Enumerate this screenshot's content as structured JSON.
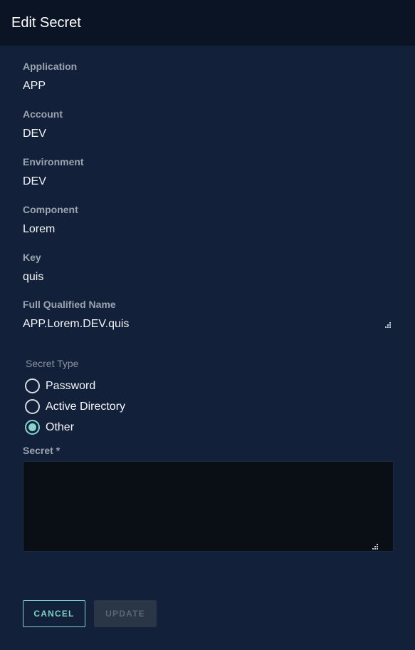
{
  "header": {
    "title": "Edit Secret"
  },
  "fields": {
    "application": {
      "label": "Application",
      "value": "APP"
    },
    "account": {
      "label": "Account",
      "value": "DEV"
    },
    "environment": {
      "label": "Environment",
      "value": "DEV"
    },
    "component": {
      "label": "Component",
      "value": "Lorem"
    },
    "key": {
      "label": "Key",
      "value": "quis"
    },
    "fqn": {
      "label": "Full Qualified Name",
      "value": "APP.Lorem.DEV.quis"
    }
  },
  "secret_type": {
    "label": "Secret Type",
    "options": [
      {
        "label": "Password",
        "checked": false
      },
      {
        "label": "Active Directory",
        "checked": false
      },
      {
        "label": "Other",
        "checked": true
      }
    ]
  },
  "secret": {
    "label": "Secret *",
    "value": ""
  },
  "buttons": {
    "cancel": "CANCEL",
    "update": "UPDATE"
  },
  "colors": {
    "accent": "#88d3cc",
    "background": "#12203a",
    "header": "#0b1424"
  }
}
